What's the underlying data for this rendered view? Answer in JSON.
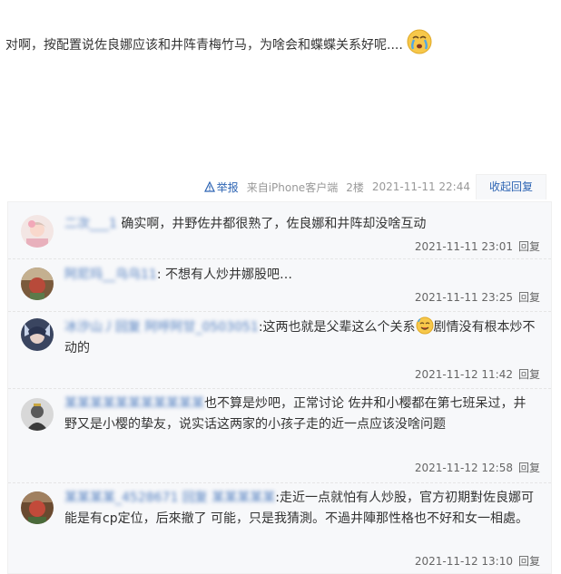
{
  "post": {
    "text": "对啊，按配置说佐良娜应该和井阵青梅竹马，为啥会和蝶蝶关系好呢....",
    "emoji": "crying-face-icon"
  },
  "meta": {
    "report": "举报",
    "source": "来自iPhone客户端",
    "floor": "2楼",
    "time": "2021-11-11 22:44",
    "toggle": "收起回复"
  },
  "replies": [
    {
      "username": "二次___1",
      "content": "确实啊，井野佐井都很熟了，佐良娜和井阵却没啥互动",
      "time": "2021-11-11 23:01",
      "reply_label": "回复"
    },
    {
      "username": "阿尼玛__乌乌11",
      "content": ": 不想有人炒井娜股吧…",
      "time": "2021-11-11 23:25",
      "reply_label": "回复"
    },
    {
      "username": "冰汐山丿回复 阿呼阿甘_0503051",
      "content_before": ":这两也就是父辈这么个关系",
      "content_after": "剧情没有根本炒不动的",
      "time": "2021-11-12 11:42",
      "reply_label": "回复"
    },
    {
      "username": "某某某某某某某某某某某",
      "content": "也不算是炒吧，正常讨论 佐井和小樱都在第七班呆过，井野又是小樱的挚友，说实话这两家的小孩子走的近一点应该没啥问题",
      "time": "2021-11-12 12:58",
      "reply_label": "回复"
    },
    {
      "username": "某某某某_4528671 回复 某某某某某",
      "content": ":走近一点就怕有人炒股，官方初期對佐良娜可能是有cp定位，后來撤了 可能，只是我猜測。不過井陣那性格也不好和女一相處。",
      "time": "2021-11-12 13:10",
      "reply_label": "回复"
    }
  ]
}
